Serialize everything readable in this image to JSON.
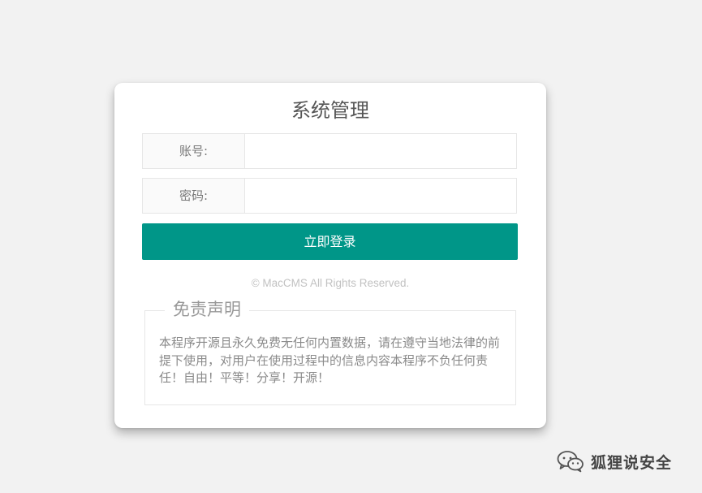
{
  "login": {
    "title": "系统管理",
    "account_label": "账号:",
    "account_value": "",
    "password_label": "密码:",
    "password_value": "",
    "submit_label": "立即登录",
    "copyright": "© MacCMS All Rights Reserved."
  },
  "disclaimer": {
    "title": "免责声明",
    "text": "本程序开源且永久免费无任何内置数据，请在遵守当地法律的前提下使用，对用户在使用过程中的信息内容本程序不负任何责任！自由！平等！分享！开源！"
  },
  "watermark": {
    "icon": "wechat-icon",
    "text": "狐狸说安全"
  },
  "colors": {
    "background": "#f2f2f2",
    "accent": "#009688"
  }
}
